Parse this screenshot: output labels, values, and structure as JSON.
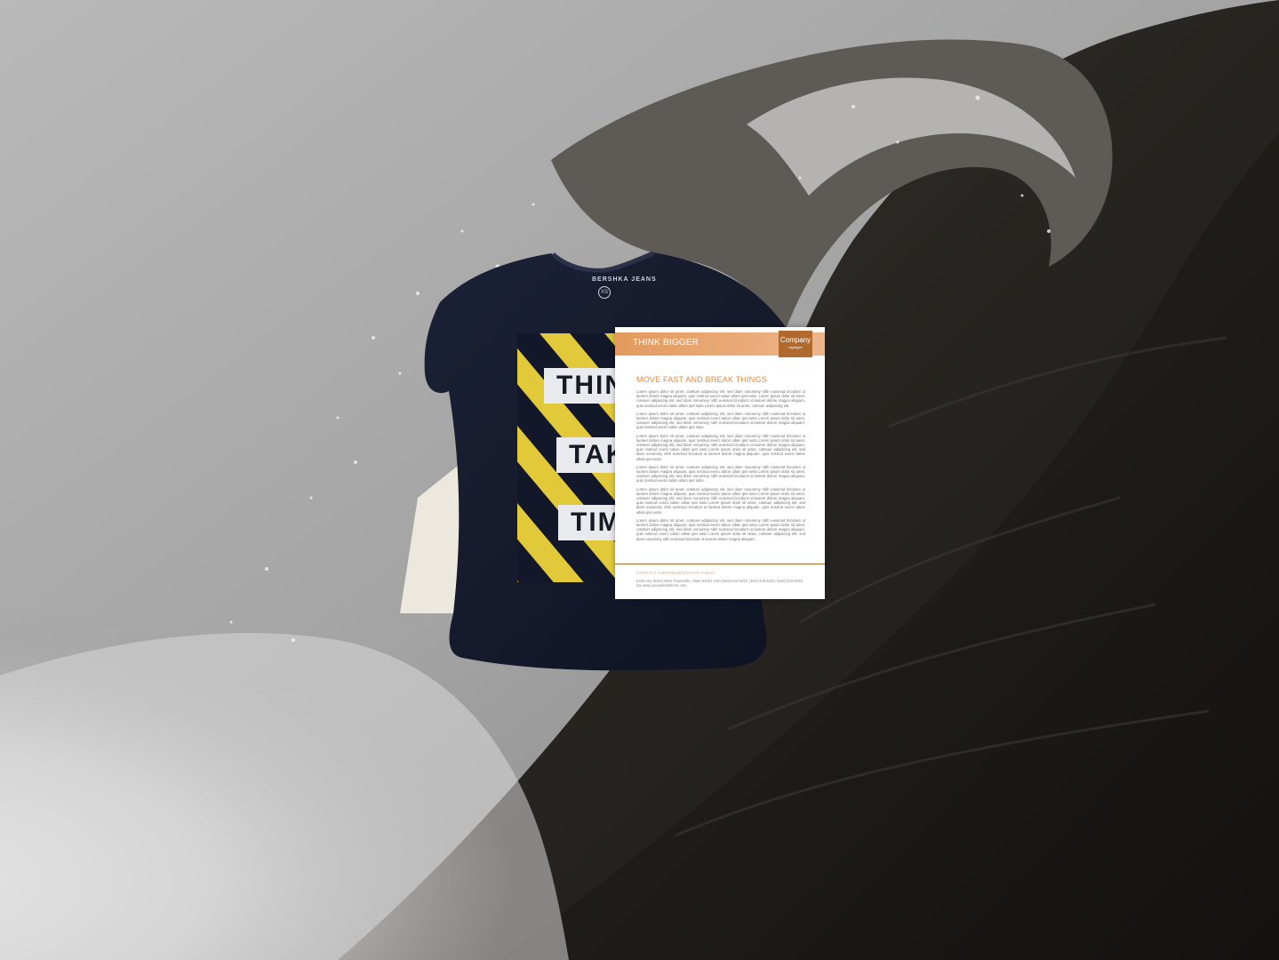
{
  "colors": {
    "shirt_navy": "#12182a",
    "stripe_yellow": "#e2c93a",
    "doc_orange": "#e39a5e",
    "doc_logo_brown": "#b06a2e",
    "wave_dark": "#1a1815",
    "wave_light": "#c9c9c9"
  },
  "shirt": {
    "collar_label": "BERSHKA JEANS",
    "size_tag": "XS",
    "word_1": "THINK",
    "word_2": "TAKE",
    "word_3": "TIME"
  },
  "document": {
    "header_title": "THINK BIGGER",
    "logo_company": "Company",
    "logo_sub": "logotype",
    "headline": "MOVE FAST AND BREAK THINGS",
    "paragraphs": [
      "Lorem ipsum dolor sit amet, cotetuer adipiscing elit, sed diam nonummy nibh euismod tincidunt ut laoreet dolore magna aliquam, quis nostrud exerci tation ullam ipet iusto. Lorem ipsum dolor sit amet, cotetuer adipiscing elit, sed diam nonummy nibh euismod tincidunt ut laoreet dolore magna aliquam, quis nostrud exerci tation ullam ipet iusto Lorem ipsum dolor sit amet, cotetuer adipiscing elit.",
      "Lorem ipsum dolor sit amet, cotetuer adipiscing elit, sed diam nonummy nibh euismod tincidunt ut laoreet dolore magna aliquam, quis nostrud exerci tation ullam ipet iusto Lorem ipsum dolor sit amet, cotetuer adipiscing elit, sed diam nonummy nibh euismod tincidunt ut laoreet dolore magna aliquam, quis nostrud exerci tation ullam ipet iusto.",
      "Lorem ipsum dolor sit amet, cotetuer adipiscing elit, sed diam nonummy nibh euismod tincidunt ut laoreet dolore magna aliquam, quis nostrud exerci tation ullam ipet iusto Lorem ipsum dolor sit amet, cotetuer adipiscing elit, sed diam nonummy nibh euismod tincidunt ut laoreet dolore magna aliquam, quis nostrud exerci tation ullam ipet iusto Lorem ipsum dolor sit amet, cotetuer adipiscing elit, sed diam nonummy nibh euismod tincidunt ut laoreet dolore magna aliquam, quis nostrud exerci tation ullam ipet iusto.",
      "Lorem ipsum dolor sit amet, cotetuer adipiscing elit, sed diam nonummy nibh euismod tincidunt ut laoreet dolore magna aliquam, quis nostrud exerci tation ullam ipet iusto Lorem ipsum dolor sit amet, cotetuer adipiscing elit, sed diam nonummy nibh euismod tincidunt ut laoreet dolore magna aliquam, quis nostrud exerci tation ullam ipet iusto.",
      "Lorem ipsum dolor sit amet, cotetuer adipiscing elit, sed diam nonummy nibh euismod tincidunt ut laoreet dolore magna aliquam, quis nostrud exerci tation ullam ipet iusto Lorem ipsum dolor sit amet, cotetuer adipiscing elit, sed diam nonummy nibh euismod tincidunt ut laoreet dolore magna aliquam, quis nostrud exerci tation ullam ipet iusto Lorem ipsum dolor sit amet, cotetuer adipiscing elit, sed diam nonummy nibh euismod tincidunt ut laoreet dolore magna aliquam, quis nostrud exerci tation ullam ipet iusto.",
      "Lorem ipsum dolor sit amet, cotetuer adipiscing elit, sed diam nonummy nibh euismod tincidunt ut laoreet dolore magna aliquam, quis nostrud exerci tation ullam ipet iusto Lorem ipsum dolor sit amet, cotetuer adipiscing elit, sed diam nonummy nibh euismod tincidunt ut laoreet dolore magna aliquam, quis nostrud exerci tation ullam ipet iusto Lorem ipsum dolor sit amet, cotetuer adipiscing elit, sed diam nonummy nibh euismod tincidunt ut laoreet dolore magna aliquam."
    ],
    "contact_title": "CONTACT A REPRESENTATIVE TODAY",
    "contact_text": "5432 Any Street West Townsville, State 54321 USA (543) 543-5432, (543) 543-5432, (543) 543-5433 fax www.yourwebsitehere.com"
  }
}
